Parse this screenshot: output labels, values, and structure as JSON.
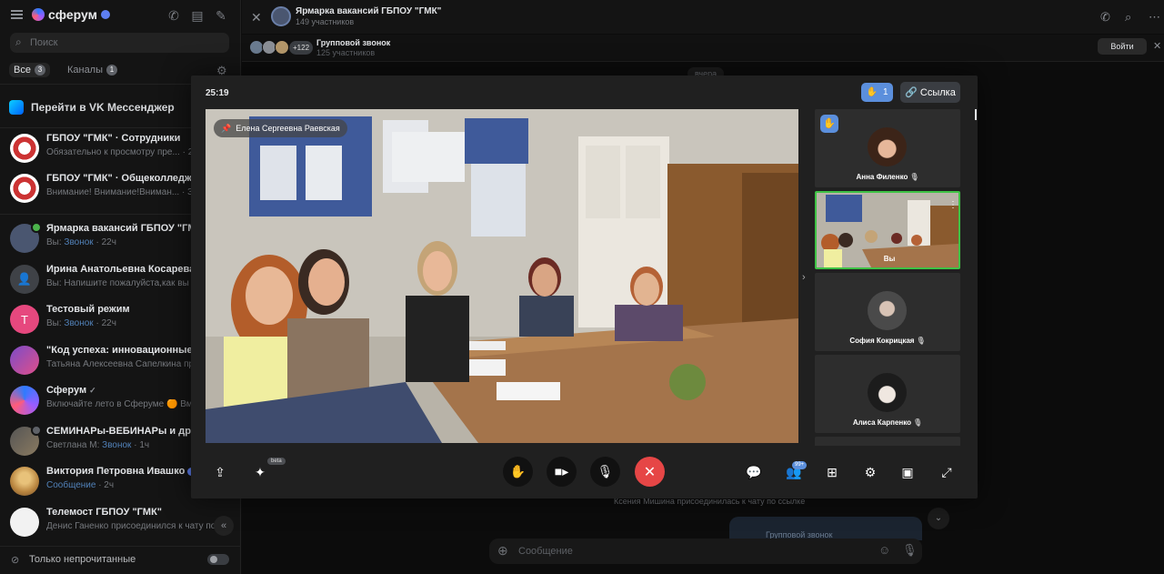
{
  "app": {
    "logo_text": "сферум"
  },
  "sidebar": {
    "search_placeholder": "Поиск",
    "filters": [
      {
        "label": "Все",
        "count": "3",
        "active": true
      },
      {
        "label": "Каналы",
        "count": "1",
        "active": false
      }
    ],
    "vk_banner": "Перейти в VK Мессенджер",
    "chats": [
      {
        "name": "ГБПОУ \"ГМК\" · Сотрудники",
        "preview": "Обязательно к просмотру пре... · 22 м"
      },
      {
        "name": "ГБПОУ \"ГМК\" · Общеколледжный",
        "preview": "Внимание! Внимание!Вниман... · 30 м"
      },
      {
        "name": "Ярмарка вакансий ГБПОУ \"ГМК\"",
        "preview_prefix": "Вы: ",
        "preview_link": "Звонок",
        "preview_suffix": " · 22ч"
      },
      {
        "name": "Ирина Анатольевна Косарева",
        "preview": "Вы: Напишите пожалуйста,как вы бу"
      },
      {
        "name": "Тестовый режим",
        "initial": "Т",
        "preview_prefix": "Вы: ",
        "preview_link": "Звонок",
        "preview_suffix": " · 22ч"
      },
      {
        "name": "\"Код успеха: инновационные иде",
        "preview": "Татьяна Алексеевна Сапелкина прис"
      },
      {
        "name": "Сферум",
        "preview": "Включайте лето в Сферуме 🟠 Вмес"
      },
      {
        "name": "СЕМИНАРы-ВЕБИНАРы и др. (УМ",
        "preview_prefix": "Светлана М: ",
        "preview_link": "Звонок",
        "preview_suffix": " · 1ч"
      },
      {
        "name": "Виктория Петровна Ивашко",
        "preview_link": "Сообщение",
        "preview_suffix": " · 2ч"
      },
      {
        "name": "Телемост ГБПОУ \"ГМК\"",
        "preview": "Денис Ганенко присоединился к чату по ..."
      }
    ],
    "unread_only": "Только непрочитанные"
  },
  "conversation": {
    "title": "Ярмарка вакансий ГБПОУ \"ГМК\"",
    "members": "149 участников",
    "call_bar": {
      "more": "+122",
      "title": "Групповой звонок",
      "participants": "125 участников",
      "join": "Войти"
    },
    "date_chip": "вчера",
    "system_message": "Ксения Мишина присоединилась к чату по ссылке",
    "call_card": "Групповой звонок",
    "composer_placeholder": "Сообщение"
  },
  "call": {
    "timer": "25:19",
    "raised_hands": "1",
    "link_label": "Ссылка",
    "pinned_speaker": "Елена Сергеевна Раевская",
    "beta": "beta",
    "participants_badge": "99+",
    "tiles": [
      {
        "name": "Анна Филенко",
        "hand_raised": true
      },
      {
        "name": "Вы",
        "self": true
      },
      {
        "name": "София Кокрицкая"
      },
      {
        "name": "Алиса Карпенко"
      }
    ]
  },
  "colors": {
    "accent": "#5b8fdc",
    "end_call": "#e64646",
    "active_tile": "#3ec245",
    "link": "#5181b8"
  }
}
